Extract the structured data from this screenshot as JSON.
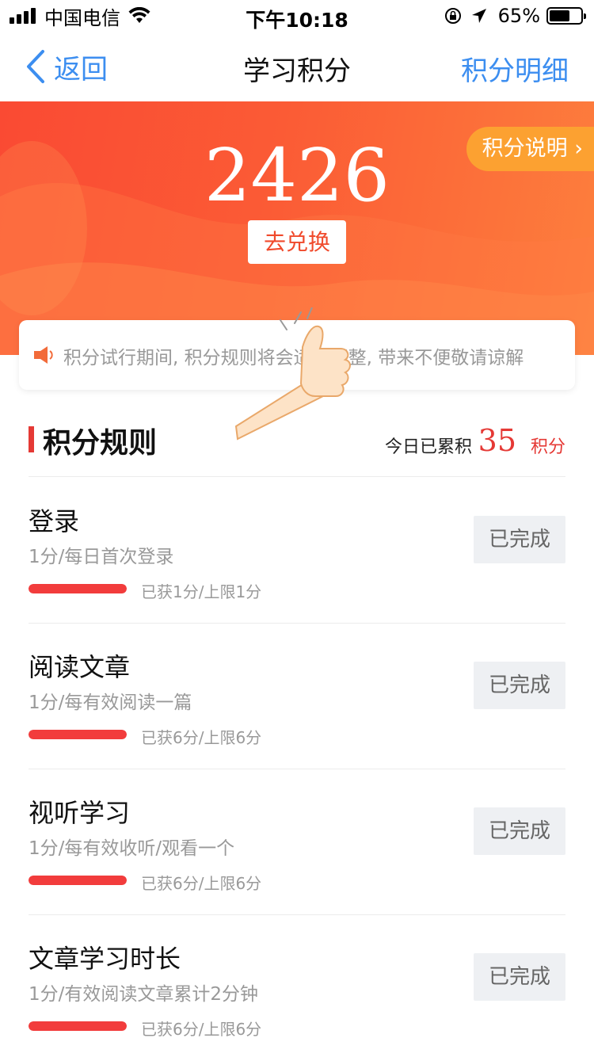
{
  "status_bar": {
    "carrier": "中国电信",
    "time": "下午10:18",
    "battery": "65%",
    "battery_level": 0.65
  },
  "nav": {
    "back_label": "返回",
    "title": "学习积分",
    "detail_label": "积分明细"
  },
  "hero": {
    "points": "2426",
    "exchange_label": "去兑换",
    "explain_label": "积分说明 ›",
    "colors": {
      "start": "#fa4a33",
      "end": "#fd7f3d",
      "explain_bg": "#fca131"
    }
  },
  "notice": {
    "text": "积分试行期间, 积分规则将会适时调整, 带来不便敬请谅解"
  },
  "rules": {
    "title": "积分规则",
    "today_label": "今日已累积",
    "today_value": "35",
    "today_unit": "积分",
    "items": [
      {
        "name": "登录",
        "desc": "1分/每日首次登录",
        "count": "已获1分/上限1分",
        "progress": 1.0,
        "status": "已完成"
      },
      {
        "name": "阅读文章",
        "desc": "1分/每有效阅读一篇",
        "count": "已获6分/上限6分",
        "progress": 1.0,
        "status": "已完成"
      },
      {
        "name": "视听学习",
        "desc": "1分/每有效收听/观看一个",
        "count": "已获6分/上限6分",
        "progress": 1.0,
        "status": "已完成"
      },
      {
        "name": "文章学习时长",
        "desc": "1分/有效阅读文章累计2分钟",
        "count": "已获6分/上限6分",
        "progress": 1.0,
        "status": "已完成"
      }
    ]
  },
  "icons": [
    "signal-icon",
    "wifi-icon",
    "rotation-lock-icon",
    "location-arrow-icon",
    "battery-icon",
    "back-chevron-icon",
    "speaker-icon",
    "thumbs-up-icon"
  ],
  "accent_colors": {
    "link": "#3c8ef0",
    "red": "#e53935",
    "progress": "#f23c3c"
  }
}
